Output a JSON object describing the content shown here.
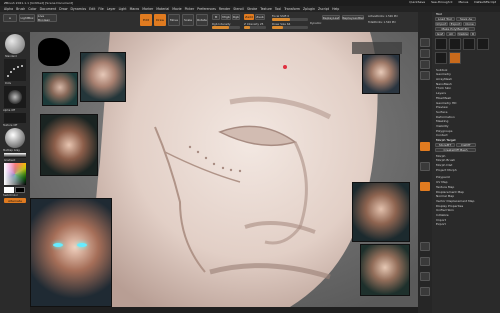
{
  "titlebar": {
    "title": "ZBrush 2021.1.1 [Untitled] [Scene Document]",
    "right": [
      "QuickSave",
      "See-through 0",
      "Menus",
      "DefaultZScript"
    ]
  },
  "menu": [
    "Alpha",
    "Brush",
    "Color",
    "Document",
    "Draw",
    "Dynamics",
    "Edit",
    "File",
    "Layer",
    "Light",
    "Macro",
    "Marker",
    "Material",
    "Movie",
    "Picker",
    "Preferences",
    "Render",
    "Stencil",
    "Stroke",
    "Texture",
    "Tool",
    "Transform",
    "Zplugin",
    "Zscript",
    "Help"
  ],
  "shelf": {
    "lightbox": "LightBox",
    "live_boolean": "Live Boolean",
    "modes": [
      "Edit",
      "Draw",
      "Move",
      "Scale",
      "Rotate"
    ],
    "channels": [
      "M",
      "Mrgb",
      "Rgb"
    ],
    "rgb_intensity": "Rgb Intensity",
    "z_add": "Zadd",
    "z_sub": "Zsub",
    "z_intensity": "Z Intensity 25",
    "focal_shift": "Focal Shift 0",
    "draw_size": "Draw Size 64",
    "dynamic": "Dynamic",
    "active_points": "ActivePoints: 1.526 Mil",
    "total_points": "TotalPoints: 1.526 Mil",
    "replay_last": "ReplayLast",
    "replay_last_rel": "ReplayLastRel"
  },
  "left": {
    "brush_label": "Standard",
    "stroke_label": "Dots",
    "alpha_label": "Alpha Off",
    "texture_label": "Texture Off",
    "material_label": "MatCap Gray",
    "gradient": "Gradient",
    "switch_color": "SwitchColor",
    "alternate": "Alternate"
  },
  "right": {
    "header": "Tool",
    "load_tool": "Load Tool",
    "save_as": "Save As",
    "import": "Import",
    "export": "Export",
    "clone": "Clone",
    "make_polymesh": "Make PolyMesh3D",
    "goz": "GoZ",
    "all": "All",
    "visible": "Visible",
    "r": "R",
    "sections": [
      "Subtool",
      "Geometry",
      "ArrayMesh",
      "NanoMesh",
      "Thick Skin",
      "Layers",
      "FiberMesh",
      "Geometry HD",
      "Preview",
      "Surface",
      "Deformation",
      "Masking",
      "Visibility",
      "Polygroups",
      "Contact",
      "Morph Target"
    ],
    "morph": [
      "StoreMT",
      "DelMT",
      "CreateDiff Mesh"
    ],
    "sliders": [
      "Morph",
      "Morph Brush",
      "Morph Dist",
      "Project Morph"
    ],
    "bottom": [
      "Polypaint",
      "UV Map",
      "Texture Map",
      "Displacement Map",
      "Normal Map",
      "Vector Displacement Map",
      "Display Properties",
      "Unified Skin",
      "Initialize",
      "Import",
      "Export"
    ]
  },
  "colors": {
    "accent": "#e07b20",
    "panel": "#2c2c2c",
    "face_skin": "#e6d8d0"
  }
}
